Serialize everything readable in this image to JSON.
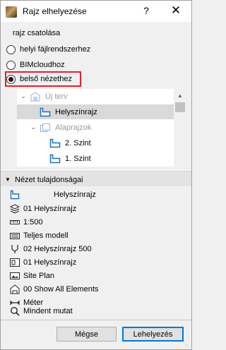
{
  "window": {
    "title": "Rajz elhelyezése",
    "help_label": "?",
    "close_label": "✕"
  },
  "link_section": {
    "label": "rajz csatolása",
    "options": [
      {
        "label": "helyi fájlrendszerhez",
        "selected": false
      },
      {
        "label": "BIMcloudhoz",
        "selected": false
      },
      {
        "label": "belső nézethez",
        "selected": true
      }
    ]
  },
  "tree": {
    "items": [
      {
        "label": "Új terv",
        "icon": "project-folder-icon",
        "expanded": true,
        "grayed": true
      },
      {
        "label": "Helyszínrajz",
        "icon": "view-icon",
        "selected": true
      },
      {
        "label": "Alaprajzok",
        "icon": "folder-icon",
        "expanded": true,
        "grayed": true
      },
      {
        "label": "2. Szint",
        "icon": "view-icon"
      },
      {
        "label": "1. Szint",
        "icon": "view-icon"
      }
    ]
  },
  "properties": {
    "header": "Nézet tulajdonságai",
    "rows": [
      {
        "icon": "view-icon",
        "value": "Helyszínrajz"
      },
      {
        "icon": "layer-combination-icon",
        "value": "01 Helyszínrajz"
      },
      {
        "icon": "scale-icon",
        "value": "1:500"
      },
      {
        "icon": "structure-display-icon",
        "value": "Teljes modell"
      },
      {
        "icon": "pen-set-icon",
        "value": "02 Helyszínrajz 500"
      },
      {
        "icon": "model-view-options-icon",
        "value": "01 Helyszínrajz"
      },
      {
        "icon": "graphic-override-icon",
        "value": "Site Plan"
      },
      {
        "icon": "renovation-filter-icon",
        "value": "00 Show All Elements"
      },
      {
        "icon": "dimension-icon",
        "value": "Méter"
      },
      {
        "icon": "zoom-icon",
        "value": "Mindent mutat"
      }
    ]
  },
  "buttons": {
    "cancel": "Mégse",
    "place": "Lehelyezés"
  },
  "colors": {
    "highlight_border": "#e4202b",
    "selected_row": "#d9d9d9",
    "view_icon_blue": "#1d6fbf",
    "default_button_border": "#0078d7"
  }
}
